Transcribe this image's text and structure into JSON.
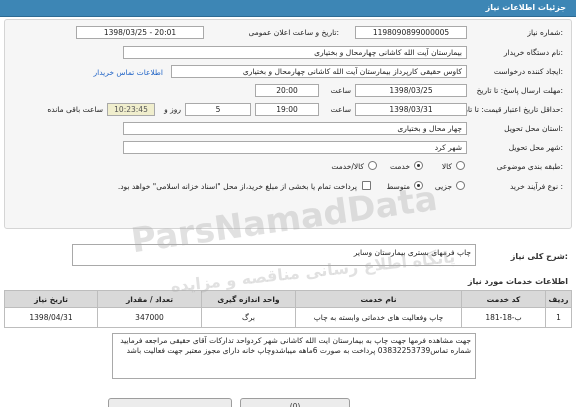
{
  "header": {
    "title": "جزئیات اطلاعات نیاز"
  },
  "form": {
    "need_number_label": "شماره نیاز:",
    "need_number": "1198090899000005",
    "announce_label": "تاریخ و ساعت اعلان عمومی:",
    "announce_value": "1398/03/25 - 20:01",
    "buyer_label": "نام دستگاه خریدار:",
    "buyer_value": "بیمارستان آیت الله کاشانی چهارمحال و بختیاری",
    "creator_label": "ایجاد کننده درخواست:",
    "creator_value": "کاوس حقیقی کارپرداز بیمارستان آیت الله کاشانی چهارمحال و بختیاری",
    "contact_link": "اطلاعات تماس خریدار",
    "send_deadline_label": "مهلت ارسال پاسخ: تا تاریخ:",
    "send_date": "1398/03/25",
    "time_label": "ساعت",
    "send_time": "20:00",
    "days_value": "5",
    "days_label": "روز و",
    "remaining_time": "10:23:45",
    "remaining_label": "ساعت باقی مانده",
    "validity_label": "حداقل تاریخ اعتبار قیمت: تا تاریخ:",
    "validity_date": "1398/03/31",
    "validity_time": "19:00",
    "province_label": "استان محل تحویل:",
    "province_value": "چهار محال و بختیاری",
    "city_label": "شهر محل تحویل:",
    "city_value": "شهر کرد",
    "category_label": "طبقه بندی موضوعی:",
    "category_options": [
      "کالا",
      "خدمت",
      "کالا/خدمت"
    ],
    "category_selected": "خدمت",
    "process_label": "نوع فرآیند خرید :",
    "process_options": [
      "جزیی",
      "متوسط"
    ],
    "process_selected": "متوسط",
    "payment_note": "پرداخت تمام یا بخشی از مبلغ خرید،از محل \"اسناد خزانه اسلامی\" خواهد بود."
  },
  "need_summary": {
    "label": "شرح کلی نیاز:",
    "value": "چاپ فرمهای بستری بیمارستان وسایر"
  },
  "services": {
    "section_title": "اطلاعات خدمات مورد نیاز",
    "columns": [
      "ردیف",
      "کد خدمت",
      "نام خدمت",
      "واحد اندازه گیری",
      "تعداد / مقدار",
      "تاریخ نیاز"
    ],
    "rows": [
      [
        "1",
        "ب-18-181",
        "چاپ وفعالیت های خدماتی وابسته به چاپ",
        "برگ",
        "347000",
        "1398/04/31"
      ]
    ]
  },
  "description": {
    "text": "جهت مشاهده فرمها جهت چاپ به بیمارستان ایت الله کاشانی شهر کردواحد تدارکات آقای حقیقی مراجعه فرمایید شماره تماس03832253739 پرداخت به صورت 6ماهه میباشدوچاپ خانه دارای مجوز معتبر جهت فعالیت باشد"
  },
  "watermark": {
    "line1": "ParsNamadData",
    "line2": "پایگاه اطلاع رسانی مناقصه و مزایده"
  },
  "footer": {
    "attachments_label": "(0)"
  }
}
